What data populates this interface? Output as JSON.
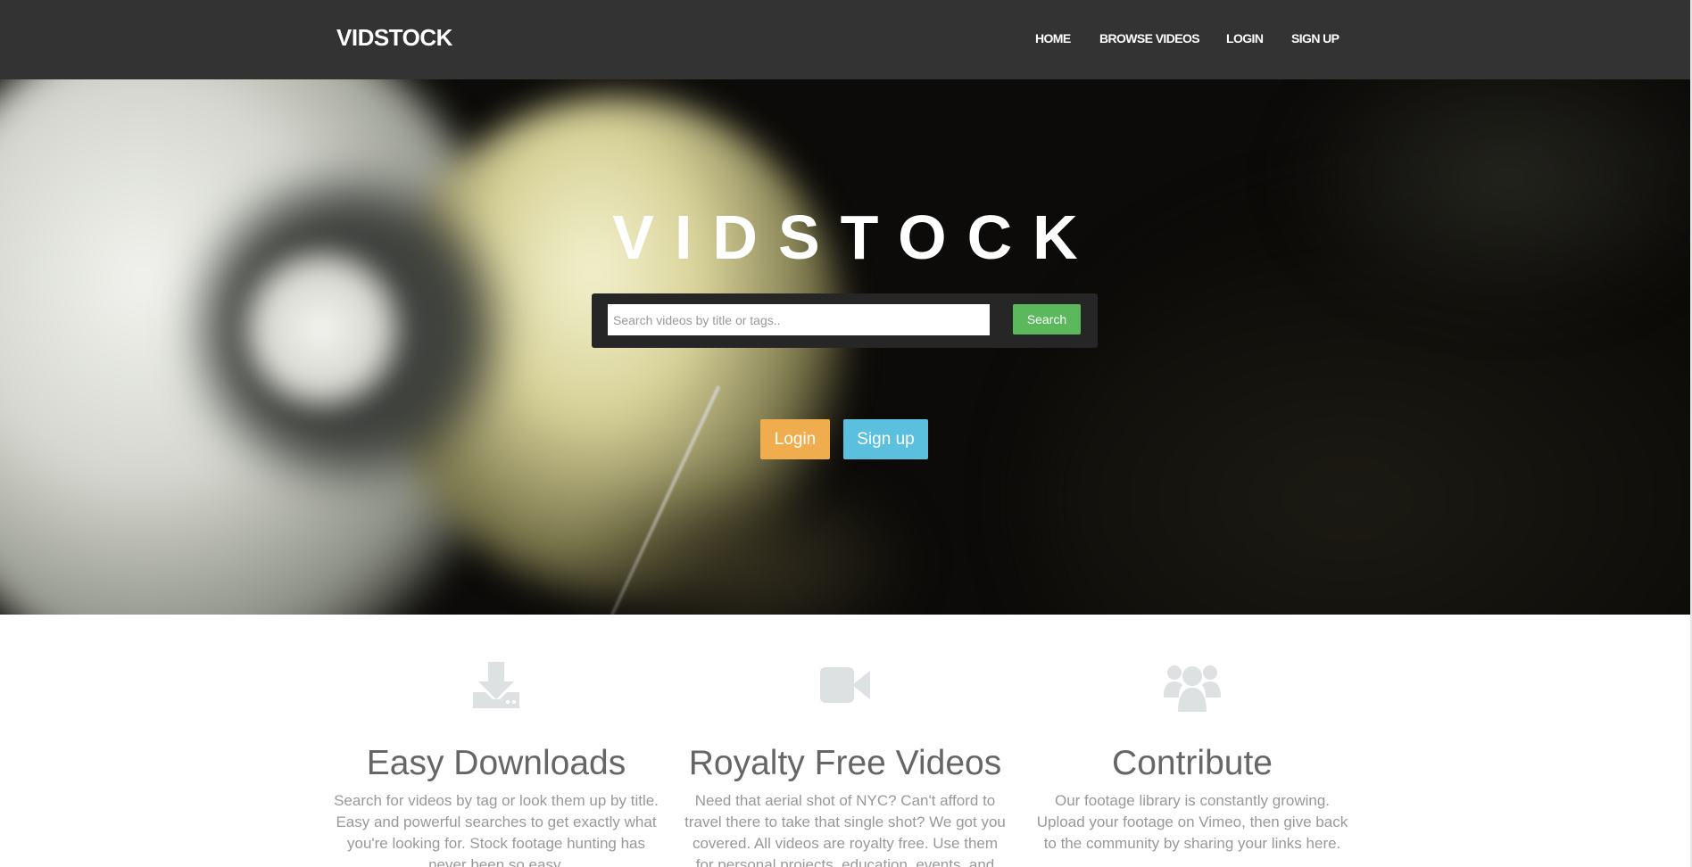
{
  "navbar": {
    "brand": "VIDSTOCK",
    "links": [
      {
        "label": "HOME"
      },
      {
        "label": "BROWSE VIDEOS"
      },
      {
        "label": "LOGIN"
      },
      {
        "label": "SIGN UP"
      }
    ],
    "background": "#333333"
  },
  "hero": {
    "title": "VIDSTOCK",
    "search": {
      "placeholder": "Search videos by title or tags..",
      "value": "",
      "button_label": "Search"
    },
    "login_label": "Login",
    "signup_label": "Sign up"
  },
  "features": [
    {
      "icon": "download-icon",
      "title": "Easy Downloads",
      "text": "Search for videos by tag or look them up by title. Easy and powerful searches to get exactly what you're looking for. Stock footage hunting has never been so easy."
    },
    {
      "icon": "video-camera-icon",
      "title": "Royalty Free Videos",
      "text": "Need that aerial shot of NYC? Can't afford to travel there to take that single shot? We got you covered. All videos are royalty free. Use them for personal projects, education, events, and more."
    },
    {
      "icon": "users-icon",
      "title": "Contribute",
      "text": "Our footage library is constantly growing. Upload your footage on Vimeo, then give back to the community by sharing your links here."
    }
  ],
  "colors": {
    "search_button": "#5cb85c",
    "login_button": "#f0ad4e",
    "signup_button": "#5bc0de",
    "icon_gray": "#dde1e1",
    "feature_title": "#666666",
    "feature_text": "#999999"
  }
}
